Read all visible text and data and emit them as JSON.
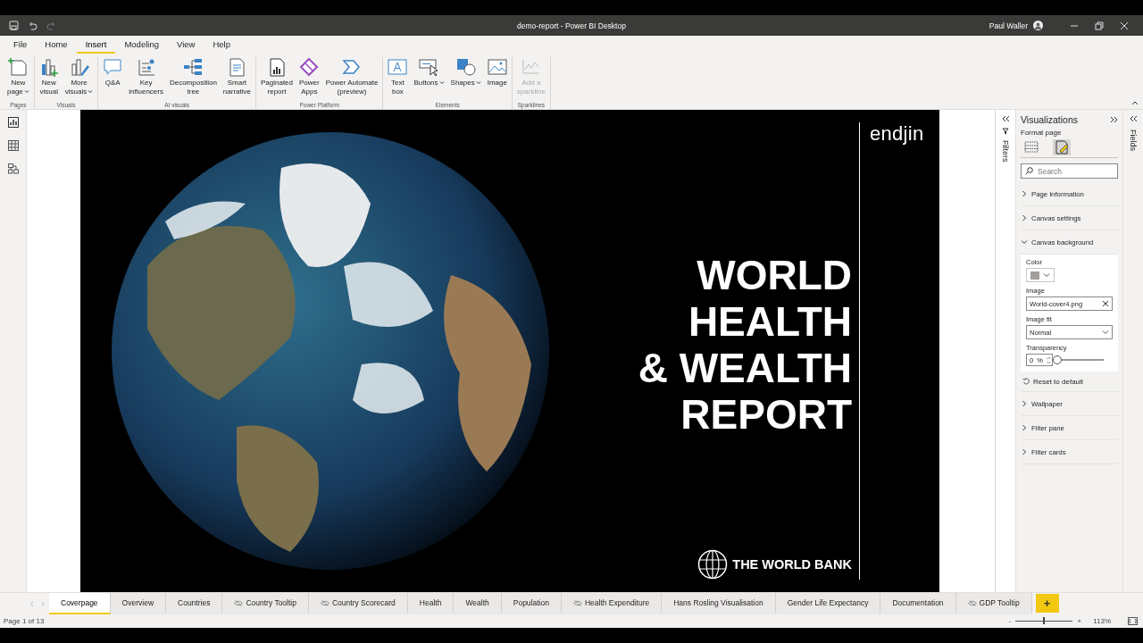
{
  "window": {
    "title": "demo-report - Power BI Desktop",
    "user": "Paul Waller"
  },
  "menu_tabs": [
    {
      "label": "File",
      "selected": false
    },
    {
      "label": "Home",
      "selected": false
    },
    {
      "label": "Insert",
      "selected": true
    },
    {
      "label": "Modeling",
      "selected": false
    },
    {
      "label": "View",
      "selected": false
    },
    {
      "label": "Help",
      "selected": false
    }
  ],
  "ribbon_groups": [
    {
      "name": "Pages",
      "buttons": [
        {
          "label": "New\npage",
          "dropdown": true,
          "disabled": false
        }
      ]
    },
    {
      "name": "Visuals",
      "buttons": [
        {
          "label": "New\nvisual",
          "dropdown": false,
          "disabled": false
        },
        {
          "label": "More\nvisuals",
          "dropdown": true,
          "disabled": false
        }
      ]
    },
    {
      "name": "AI visuals",
      "buttons": [
        {
          "label": "Q&A",
          "dropdown": false,
          "disabled": false
        },
        {
          "label": "Key\ninfluencers",
          "dropdown": false,
          "disabled": false
        },
        {
          "label": "Decomposition\ntree",
          "dropdown": false,
          "disabled": false
        },
        {
          "label": "Smart\nnarrative",
          "dropdown": false,
          "disabled": false
        }
      ]
    },
    {
      "name": "Power Platform",
      "buttons": [
        {
          "label": "Paginated\nreport",
          "dropdown": false,
          "disabled": false
        },
        {
          "label": "Power\nApps",
          "dropdown": false,
          "disabled": false
        },
        {
          "label": "Power Automate\n(preview)",
          "dropdown": false,
          "disabled": false
        }
      ]
    },
    {
      "name": "Elements",
      "buttons": [
        {
          "label": "Text\nbox",
          "dropdown": false,
          "disabled": false
        },
        {
          "label": "Buttons",
          "dropdown": true,
          "disabled": false
        },
        {
          "label": "Shapes",
          "dropdown": true,
          "disabled": false
        },
        {
          "label": "Image",
          "dropdown": false,
          "disabled": false
        }
      ]
    },
    {
      "name": "Sparklines",
      "buttons": [
        {
          "label": "Add a\nsparkline",
          "dropdown": false,
          "disabled": true
        }
      ]
    }
  ],
  "canvas": {
    "logo": "endjin",
    "title": "WORLD\nHEALTH\n& WEALTH\nREPORT",
    "footer_logo": "THE WORLD BANK"
  },
  "filters_pane": {
    "label": "Filters"
  },
  "visualizations_pane": {
    "title": "Visualizations",
    "subtitle": "Format page",
    "format_tabs": [
      {
        "selected": false
      },
      {
        "selected": true
      }
    ],
    "search": {
      "placeholder": "Search"
    },
    "sections": [
      {
        "label": "Page information",
        "expanded": false
      },
      {
        "label": "Canvas settings",
        "expanded": false
      },
      {
        "label": "Canvas background",
        "expanded": true,
        "content": {
          "color_label": "Color",
          "image_label": "Image",
          "image_value": "World-cover4.png",
          "image_fit_label": "Image fit",
          "image_fit_value": "Normal",
          "transparency_label": "Transparency",
          "transparency_value": "0",
          "transparency_unit": "%",
          "transparency": {
            "level": 0
          },
          "reset_label": "Reset to default"
        }
      },
      {
        "label": "Wallpaper",
        "expanded": false
      },
      {
        "label": "Filter pane",
        "expanded": false
      },
      {
        "label": "Filter cards",
        "expanded": false
      }
    ]
  },
  "fields_pane": {
    "label": "Fields"
  },
  "page_tabs": [
    {
      "label": "Coverpage",
      "selected": true,
      "hidden": false
    },
    {
      "label": "Overview",
      "selected": false,
      "hidden": false
    },
    {
      "label": "Countries",
      "selected": false,
      "hidden": false
    },
    {
      "label": "Country Tooltip",
      "selected": false,
      "hidden": true
    },
    {
      "label": "Country Scorecard",
      "selected": false,
      "hidden": true
    },
    {
      "label": "Health",
      "selected": false,
      "hidden": false
    },
    {
      "label": "Wealth",
      "selected": false,
      "hidden": false
    },
    {
      "label": "Population",
      "selected": false,
      "hidden": false
    },
    {
      "label": "Health Expenditure",
      "selected": false,
      "hidden": true
    },
    {
      "label": "Hans Rosling Visualisation",
      "selected": false,
      "hidden": false
    },
    {
      "label": "Gender Life Expectancy",
      "selected": false,
      "hidden": false
    },
    {
      "label": "Documentation",
      "selected": false,
      "hidden": false
    },
    {
      "label": "GDP Tooltip",
      "selected": false,
      "hidden": true
    }
  ],
  "add_page": "+",
  "status_bar": {
    "page": "Page 1 of 13",
    "zoom_minus": "-",
    "zoom_plus": "+",
    "zoom": {
      "level": 0.5
    },
    "zoom_value": "113%"
  }
}
